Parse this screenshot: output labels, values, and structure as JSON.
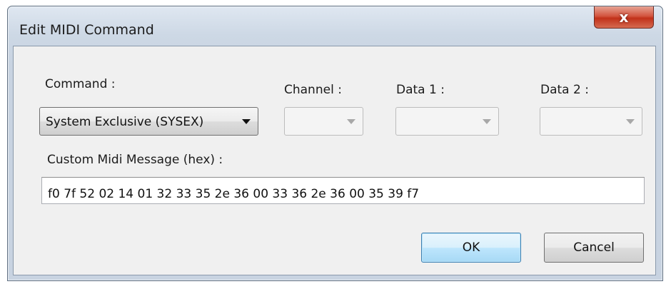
{
  "window": {
    "title": "Edit MIDI Command",
    "close_label": "x"
  },
  "command": {
    "label": "Command :",
    "value": "System Exclusive (SYSEX)"
  },
  "channel": {
    "label": "Channel :",
    "value": ""
  },
  "data1": {
    "label": "Data 1 :",
    "value": ""
  },
  "data2": {
    "label": "Data 2 :",
    "value": ""
  },
  "custom": {
    "label": "Custom Midi Message (hex) :",
    "value": "f0 7f 52 02 14 01 32 33 35 2e 36 00 33 36 2e 36 00 35 39 f7"
  },
  "buttons": {
    "ok": "OK",
    "cancel": "Cancel"
  }
}
